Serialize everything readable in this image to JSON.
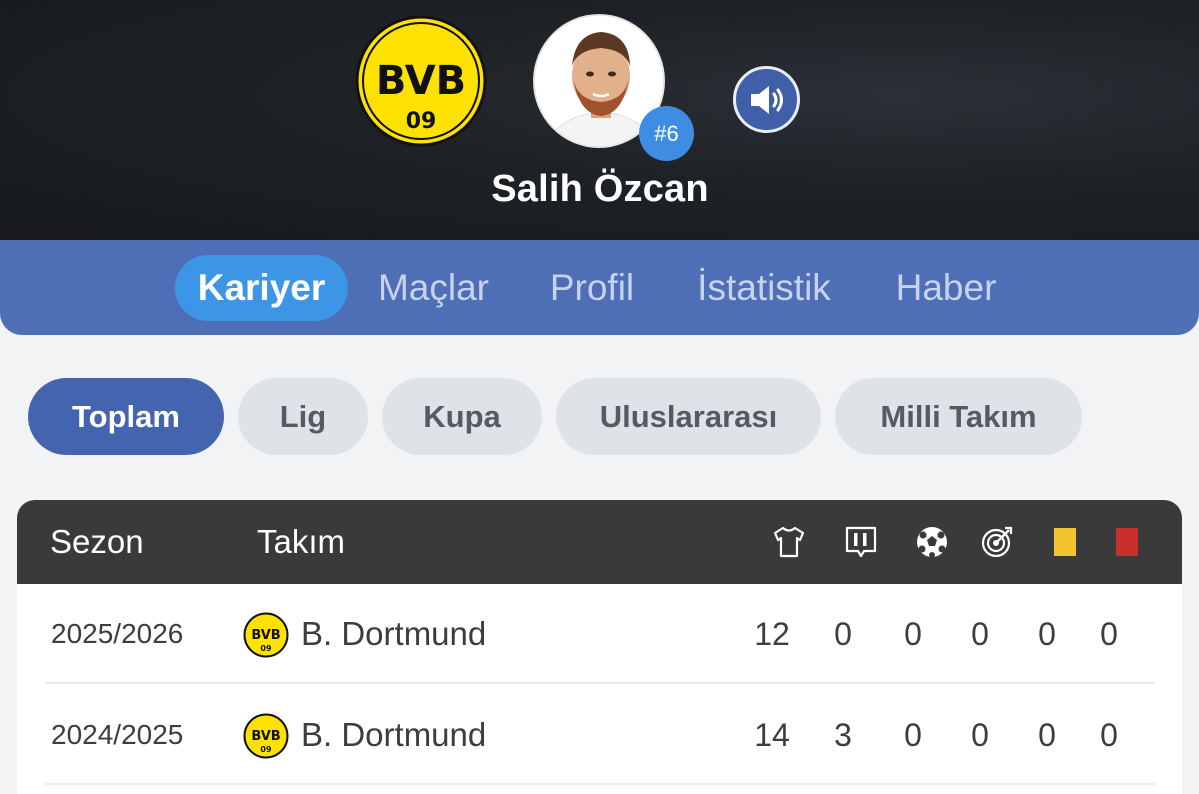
{
  "player": {
    "name": "Salih Özcan",
    "shirt_number": "#6"
  },
  "club": {
    "logo_text_top": "BVB",
    "logo_text_bottom": "09"
  },
  "tabs": [
    "Kariyer",
    "Maçlar",
    "Profil",
    "İstatistik",
    "Haber"
  ],
  "active_tab": "Kariyer",
  "filters": [
    "Toplam",
    "Lig",
    "Kupa",
    "Uluslararası",
    "Milli Takım"
  ],
  "active_filter": "Toplam",
  "table": {
    "headers": {
      "season": "Sezon",
      "team": "Takım"
    },
    "stat_icons": [
      "jersey-icon",
      "lineup-icon",
      "football-icon",
      "target-icon",
      "yellow-card-icon",
      "red-card-icon"
    ],
    "rows": [
      {
        "season": "2025/2026",
        "team": "B. Dortmund",
        "stats": [
          "12",
          "0",
          "0",
          "0",
          "0",
          "0"
        ]
      },
      {
        "season": "2024/2025",
        "team": "B. Dortmund",
        "stats": [
          "14",
          "3",
          "0",
          "0",
          "0",
          "0"
        ]
      }
    ]
  },
  "colors": {
    "brand_blue": "#4e6fb5",
    "active_tab": "#3d95e6",
    "active_filter": "#4564b0",
    "yellow_card": "#f4c430",
    "red_card": "#c9302c",
    "club_yellow": "#fde100"
  }
}
